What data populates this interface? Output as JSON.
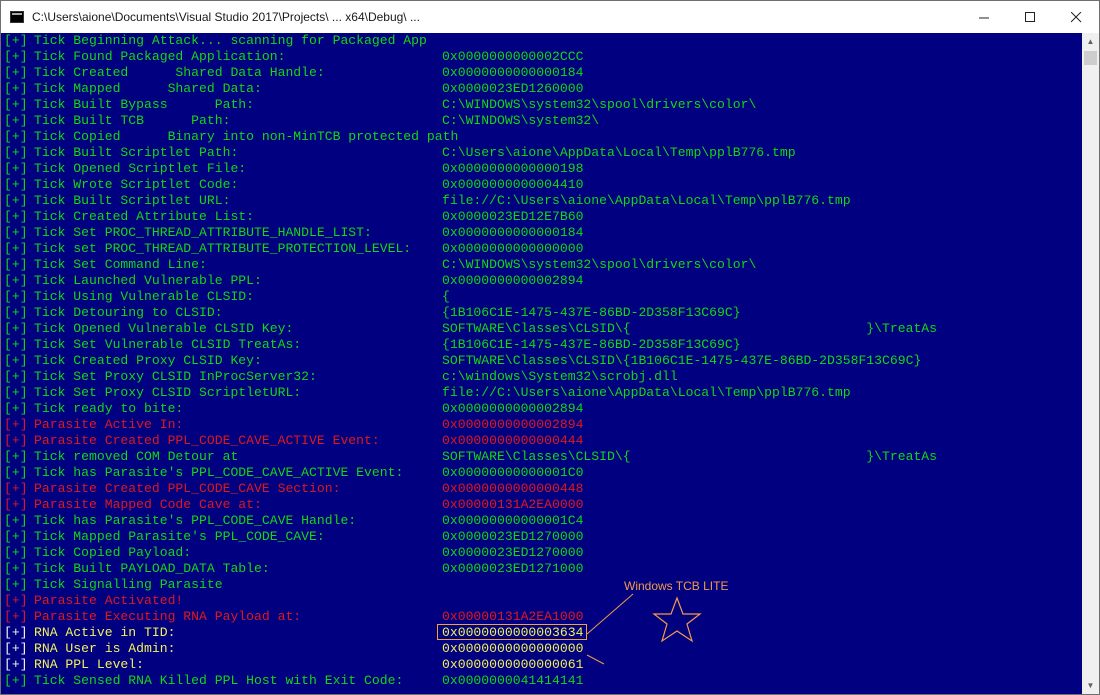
{
  "window": {
    "title": "C:\\Users\\aione\\Documents\\Visual Studio 2017\\Projects\\ ...  x64\\Debug\\ ..."
  },
  "colors": {
    "background": "#000080",
    "tick": "#13d813",
    "parasite": "#e0181d",
    "rna": "#f2f25a",
    "annotation": "#f59a4a"
  },
  "prefix": "[+]",
  "annotation": {
    "label": "Windows TCB LITE"
  },
  "lines": [
    {
      "kind": "tick",
      "msg": "Tick Beginning Attack... scanning for Packaged App",
      "val": ""
    },
    {
      "kind": "tick",
      "msg": "Tick Found Packaged Application:",
      "val": "0x0000000000002CCC"
    },
    {
      "kind": "tick",
      "msg": "Tick Created      Shared Data Handle:",
      "val": "0x0000000000000184"
    },
    {
      "kind": "tick",
      "msg": "Tick Mapped      Shared Data:",
      "val": "0x0000023ED1260000"
    },
    {
      "kind": "tick",
      "msg": "Tick Built Bypass      Path:",
      "val": "C:\\WINDOWS\\system32\\spool\\drivers\\color\\"
    },
    {
      "kind": "tick",
      "msg": "Tick Built TCB      Path:",
      "val": "C:\\WINDOWS\\system32\\"
    },
    {
      "kind": "tick",
      "msg": "Tick Copied      Binary into non-MinTCB protected path",
      "val": ""
    },
    {
      "kind": "tick",
      "msg": "Tick Built Scriptlet Path:",
      "val": "C:\\Users\\aione\\AppData\\Local\\Temp\\pplB776.tmp"
    },
    {
      "kind": "tick",
      "msg": "Tick Opened Scriptlet File:",
      "val": "0x0000000000000198"
    },
    {
      "kind": "tick",
      "msg": "Tick Wrote Scriptlet Code:",
      "val": "0x0000000000004410"
    },
    {
      "kind": "tick",
      "msg": "Tick Built Scriptlet URL:",
      "val": "file://C:\\Users\\aione\\AppData\\Local\\Temp\\pplB776.tmp"
    },
    {
      "kind": "tick",
      "msg": "Tick Created Attribute List:",
      "val": "0x0000023ED12E7B60"
    },
    {
      "kind": "tick",
      "msg": "Tick Set PROC_THREAD_ATTRIBUTE_HANDLE_LIST:",
      "val": "0x0000000000000184"
    },
    {
      "kind": "tick",
      "msg": "Tick set PROC_THREAD_ATTRIBUTE_PROTECTION_LEVEL:",
      "val": "0x0000000000000000"
    },
    {
      "kind": "tick",
      "msg": "Tick Set Command Line:",
      "val": "C:\\WINDOWS\\system32\\spool\\drivers\\color\\"
    },
    {
      "kind": "tick",
      "msg": "Tick Launched Vulnerable PPL:",
      "val": "0x0000000000002894"
    },
    {
      "kind": "tick",
      "msg": "Tick Using Vulnerable CLSID:",
      "val": "{"
    },
    {
      "kind": "tick",
      "msg": "Tick Detouring to CLSID:",
      "val": "{1B106C1E-1475-437E-86BD-2D358F13C69C}"
    },
    {
      "kind": "tick",
      "msg": "Tick Opened Vulnerable CLSID Key:",
      "val": "SOFTWARE\\Classes\\CLSID\\{                              }\\TreatAs"
    },
    {
      "kind": "tick",
      "msg": "Tick Set Vulnerable CLSID TreatAs:",
      "val": "{1B106C1E-1475-437E-86BD-2D358F13C69C}"
    },
    {
      "kind": "tick",
      "msg": "Tick Created Proxy CLSID Key:",
      "val": "SOFTWARE\\Classes\\CLSID\\{1B106C1E-1475-437E-86BD-2D358F13C69C}"
    },
    {
      "kind": "tick",
      "msg": "Tick Set Proxy CLSID InProcServer32:",
      "val": "c:\\windows\\System32\\scrobj.dll"
    },
    {
      "kind": "tick",
      "msg": "Tick Set Proxy CLSID ScriptletURL:",
      "val": "file://C:\\Users\\aione\\AppData\\Local\\Temp\\pplB776.tmp"
    },
    {
      "kind": "tick",
      "msg": "Tick ready to bite:",
      "val": "0x0000000000002894"
    },
    {
      "kind": "parasite",
      "msg": "Parasite Active In:",
      "val": "0x0000000000002894"
    },
    {
      "kind": "parasite",
      "msg": "Parasite Created PPL_CODE_CAVE_ACTIVE Event:",
      "val": "0x0000000000000444"
    },
    {
      "kind": "tick",
      "msg": "Tick removed COM Detour at",
      "val": "SOFTWARE\\Classes\\CLSID\\{                              }\\TreatAs"
    },
    {
      "kind": "tick",
      "msg": "Tick has Parasite's PPL_CODE_CAVE_ACTIVE Event:",
      "val": "0x00000000000001C0"
    },
    {
      "kind": "parasite",
      "msg": "Parasite Created PPL_CODE_CAVE Section:",
      "val": "0x0000000000000448"
    },
    {
      "kind": "parasite",
      "msg": "Parasite Mapped Code Cave at:",
      "val": "0x00000131A2EA0000"
    },
    {
      "kind": "tick",
      "msg": "Tick has Parasite's PPL_CODE_CAVE Handle:",
      "val": "0x00000000000001C4"
    },
    {
      "kind": "tick",
      "msg": "Tick Mapped Parasite's PPL_CODE_CAVE:",
      "val": "0x0000023ED1270000"
    },
    {
      "kind": "tick",
      "msg": "Tick Copied Payload:",
      "val": "0x0000023ED1270000"
    },
    {
      "kind": "tick",
      "msg": "Tick Built PAYLOAD_DATA Table:",
      "val": "0x0000023ED1271000"
    },
    {
      "kind": "tick",
      "msg": "Tick Signalling Parasite",
      "val": ""
    },
    {
      "kind": "parasite",
      "msg": "Parasite Activated!",
      "val": ""
    },
    {
      "kind": "parasite",
      "msg": "Parasite Executing RNA Payload at:",
      "val": "0x00000131A2EA1000"
    },
    {
      "kind": "rna",
      "msg": "RNA Active in TID:",
      "val": "0x0000000000003634"
    },
    {
      "kind": "rna",
      "msg": "RNA User is Admin:",
      "val": "0x0000000000000000"
    },
    {
      "kind": "rna",
      "msg": "RNA PPL Level:",
      "val": "0x0000000000000061"
    },
    {
      "kind": "tick",
      "msg": "Tick Sensed RNA Killed PPL Host with Exit Code:",
      "val": "0x0000000041414141"
    }
  ]
}
